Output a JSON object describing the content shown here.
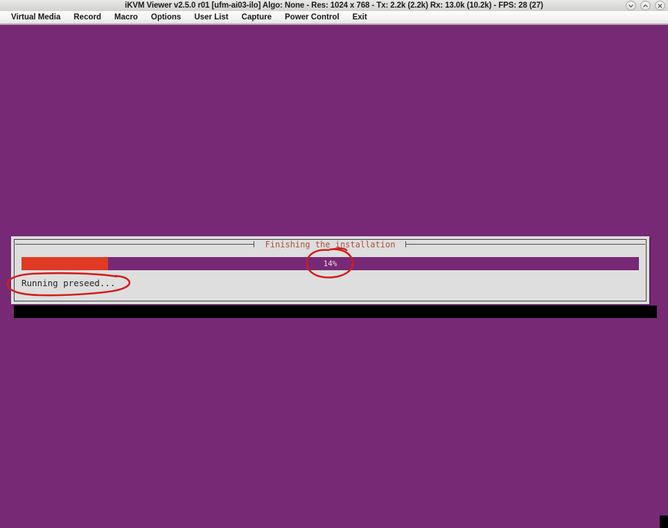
{
  "window": {
    "title": "iKVM Viewer v2.5.0 r01 [ufm-ai03-ilo] Algo: None - Res: 1024 x 768 - Tx: 2.2k (2.2k) Rx: 13.0k (10.2k) - FPS: 28 (27)",
    "app_name": "iKVM Viewer",
    "version": "v2.5.0 r01",
    "host": "ufm-ai03-ilo",
    "algo": "None",
    "resolution": "1024 x 768",
    "tx": "2.2k (2.2k)",
    "rx": "13.0k (10.2k)",
    "fps": "28 (27)",
    "controls": [
      {
        "name": "minimize-button",
        "glyph": "chevron-down"
      },
      {
        "name": "maximize-button",
        "glyph": "chevron-up"
      },
      {
        "name": "close-button",
        "glyph": "cross"
      }
    ]
  },
  "menubar": {
    "items": [
      {
        "label": "Virtual Media"
      },
      {
        "label": "Record"
      },
      {
        "label": "Macro"
      },
      {
        "label": "Options"
      },
      {
        "label": "User List"
      },
      {
        "label": "Capture"
      },
      {
        "label": "Power Control"
      },
      {
        "label": "Exit"
      }
    ]
  },
  "installer": {
    "title": "Finishing the installation",
    "progress_percent": 14,
    "progress_label": "14%",
    "status_text": "Running preseed...",
    "colors": {
      "background": "#772975",
      "dialog": "#dedede",
      "progress_fill": "#e03a24",
      "progress_track": "#772975",
      "title_text": "#b14d40",
      "annotation": "#d41b1b"
    }
  },
  "annotations": [
    {
      "name": "annotation-ellipse-progress",
      "target": "14%",
      "shape": "hand-drawn-ellipse",
      "color": "#d41b1b"
    },
    {
      "name": "annotation-ellipse-status",
      "target": "Running preseed...",
      "shape": "hand-drawn-ellipse",
      "color": "#d41b1b"
    }
  ]
}
